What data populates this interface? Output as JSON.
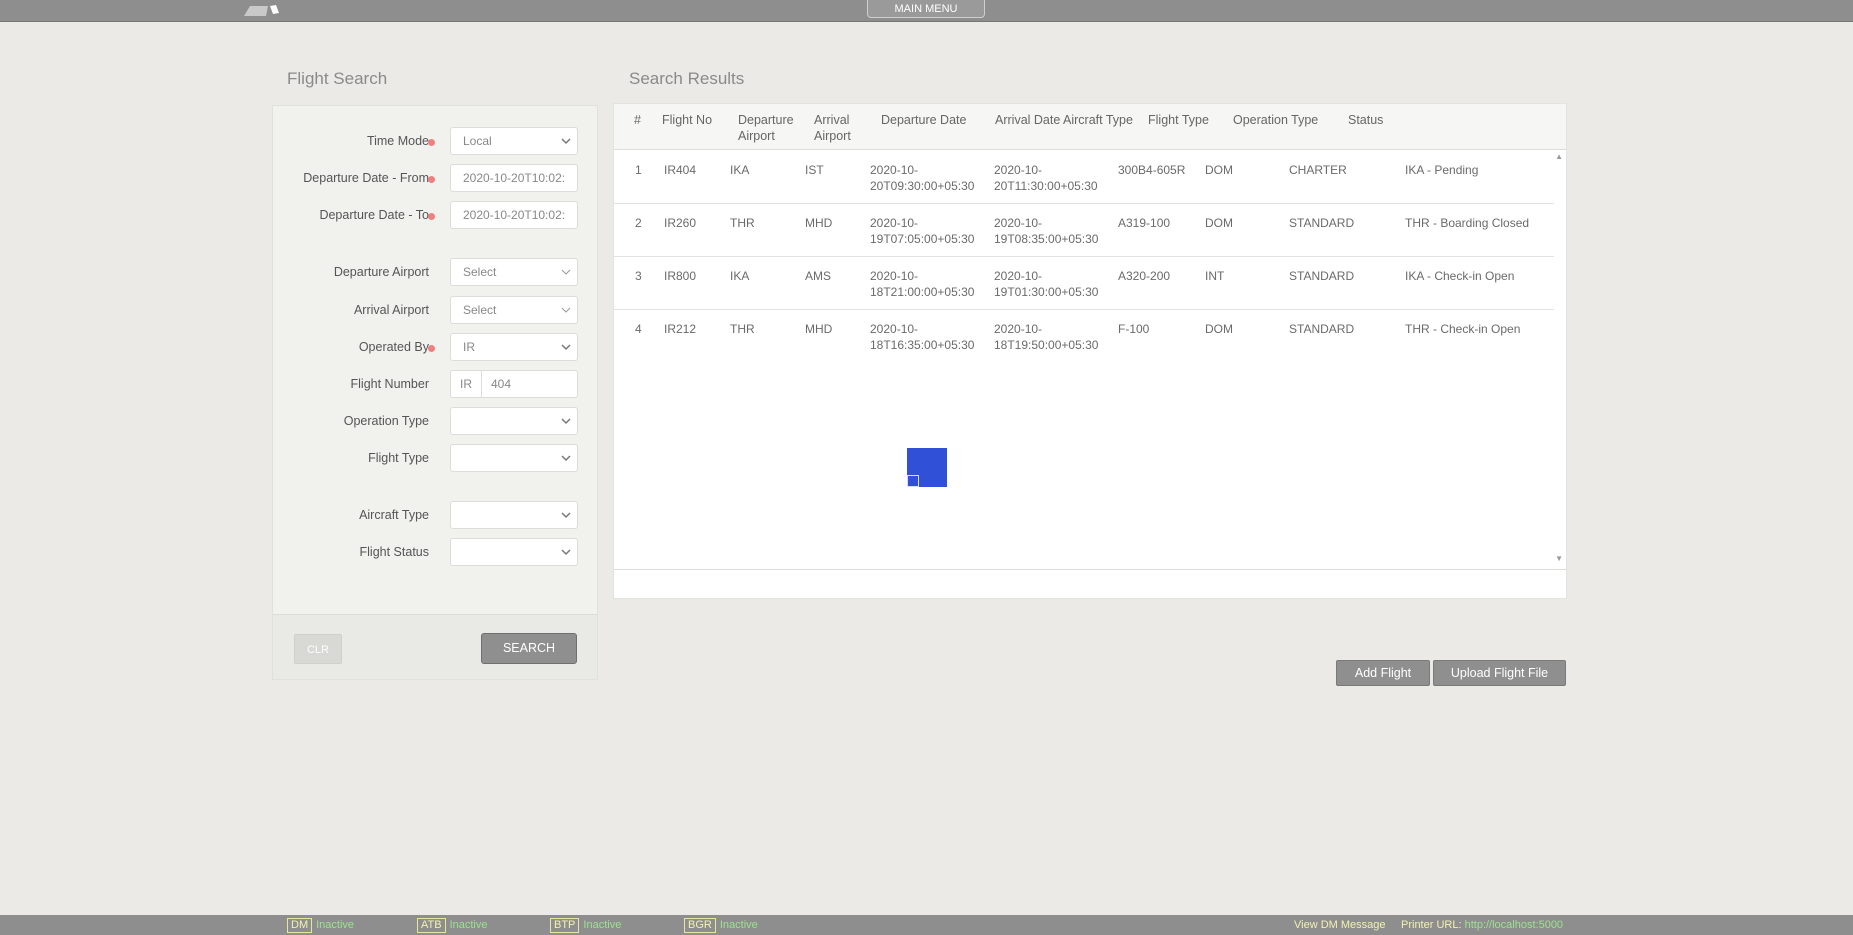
{
  "topbar": {
    "main_menu": "MAIN MENU"
  },
  "search_panel": {
    "title": "Flight Search",
    "fields": {
      "time_mode": {
        "label": "Time Mode",
        "value": "Local"
      },
      "dep_from": {
        "label": "Departure Date - From",
        "value": "2020-10-20T10:02:"
      },
      "dep_to": {
        "label": "Departure Date - To",
        "value": "2020-10-20T10:02:"
      },
      "dep_airport": {
        "label": "Departure Airport",
        "value": "Select"
      },
      "arr_airport": {
        "label": "Arrival Airport",
        "value": "Select"
      },
      "operated_by": {
        "label": "Operated By",
        "value": "IR"
      },
      "flight_number": {
        "label": "Flight Number",
        "prefix": "IR",
        "value": "404"
      },
      "operation_type": {
        "label": "Operation Type",
        "value": ""
      },
      "flight_type": {
        "label": "Flight Type",
        "value": ""
      },
      "aircraft_type": {
        "label": "Aircraft Type",
        "value": ""
      },
      "flight_status": {
        "label": "Flight Status",
        "value": ""
      }
    },
    "clear_label": "CLR",
    "search_label": "SEARCH"
  },
  "results": {
    "title": "Search Results",
    "columns": {
      "num": "#",
      "flight_no": "Flight No",
      "dep_airport": "Departure Airport",
      "arr_airport": "Arrival Airport",
      "dep_date": "Departure Date",
      "arr_date": "Arrival Date",
      "aircraft": "Aircraft Type",
      "flight_type": "Flight Type",
      "operation": "Operation Type",
      "status": "Status"
    },
    "rows": [
      {
        "num": "1",
        "flight_no": "IR404",
        "dep": "IKA",
        "arr": "IST",
        "dep_date": "2020-10-20T09:30:00+05:30",
        "arr_date": "2020-10-20T11:30:00+05:30",
        "aircraft": "300B4-605R",
        "type": "DOM",
        "operation": "CHARTER",
        "status": "IKA - Pending"
      },
      {
        "num": "2",
        "flight_no": "IR260",
        "dep": "THR",
        "arr": "MHD",
        "dep_date": "2020-10-19T07:05:00+05:30",
        "arr_date": "2020-10-19T08:35:00+05:30",
        "aircraft": "A319-100",
        "type": "DOM",
        "operation": "STANDARD",
        "status": "THR - Boarding Closed"
      },
      {
        "num": "3",
        "flight_no": "IR800",
        "dep": "IKA",
        "arr": "AMS",
        "dep_date": "2020-10-18T21:00:00+05:30",
        "arr_date": "2020-10-19T01:30:00+05:30",
        "aircraft": "A320-200",
        "type": "INT",
        "operation": "STANDARD",
        "status": "IKA - Check-in Open"
      },
      {
        "num": "4",
        "flight_no": "IR212",
        "dep": "THR",
        "arr": "MHD",
        "dep_date": "2020-10-18T16:35:00+05:30",
        "arr_date": "2020-10-18T19:50:00+05:30",
        "aircraft": "F-100",
        "type": "DOM",
        "operation": "STANDARD",
        "status": "THR - Check-in Open"
      }
    ]
  },
  "actions": {
    "add_flight": "Add Flight",
    "upload_file": "Upload Flight File"
  },
  "statusbar": {
    "items": [
      {
        "code": "DM",
        "state": "Inactive"
      },
      {
        "code": "ATB",
        "state": "Inactive"
      },
      {
        "code": "BTP",
        "state": "Inactive"
      },
      {
        "code": "BGR",
        "state": "Inactive"
      }
    ],
    "view_dm": "View DM Message",
    "printer_label": "Printer URL:",
    "printer_url": "http://localhost:5000"
  },
  "colors": {
    "accent": "#3050d8",
    "required": "#f08080",
    "status_active_text": "#9be38f"
  }
}
